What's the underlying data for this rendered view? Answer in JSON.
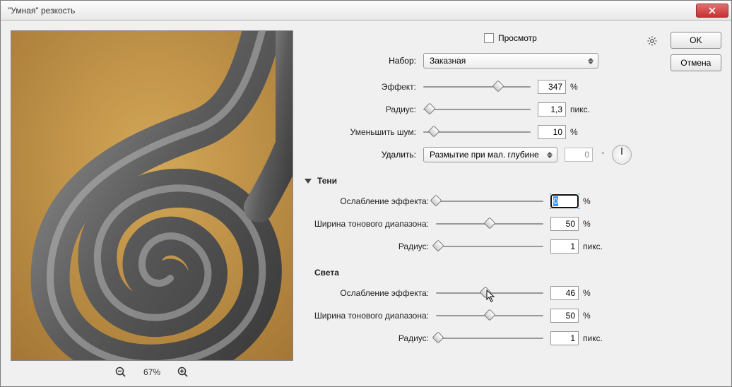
{
  "window": {
    "title": "\"Умная\" резкость"
  },
  "buttons": {
    "ok": "OK",
    "cancel": "Отмена",
    "close": "X"
  },
  "preview_cb": {
    "label": "Просмотр",
    "checked": false
  },
  "zoom": {
    "percent": "67%"
  },
  "set": {
    "label": "Набор:",
    "value": "Заказная"
  },
  "amount": {
    "label": "Эффект:",
    "value": "347",
    "unit": "%",
    "pos": 70
  },
  "radius": {
    "label": "Радиус:",
    "value": "1,3",
    "unit": "пикс.",
    "pos": 6
  },
  "noise": {
    "label": "Уменьшить шум:",
    "value": "10",
    "unit": "%",
    "pos": 10
  },
  "remove": {
    "label": "Удалить:",
    "value": "Размытие при мал. глубине",
    "angle": "0",
    "angle_unit": "°"
  },
  "shadows": {
    "title": "Тени",
    "fade": {
      "label": "Ослабление эффекта:",
      "value": "0",
      "unit": "%",
      "pos": 0,
      "focused": true
    },
    "tonal": {
      "label": "Ширина тонового диапазона:",
      "value": "50",
      "unit": "%",
      "pos": 50
    },
    "radius": {
      "label": "Радиус:",
      "value": "1",
      "unit": "пикс.",
      "pos": 2
    }
  },
  "highlights": {
    "title": "Света",
    "fade": {
      "label": "Ослабление эффекта:",
      "value": "46",
      "unit": "%",
      "pos": 46
    },
    "tonal": {
      "label": "Ширина тонового диапазона:",
      "value": "50",
      "unit": "%",
      "pos": 50
    },
    "radius": {
      "label": "Радиус:",
      "value": "1",
      "unit": "пикс.",
      "pos": 2
    }
  }
}
